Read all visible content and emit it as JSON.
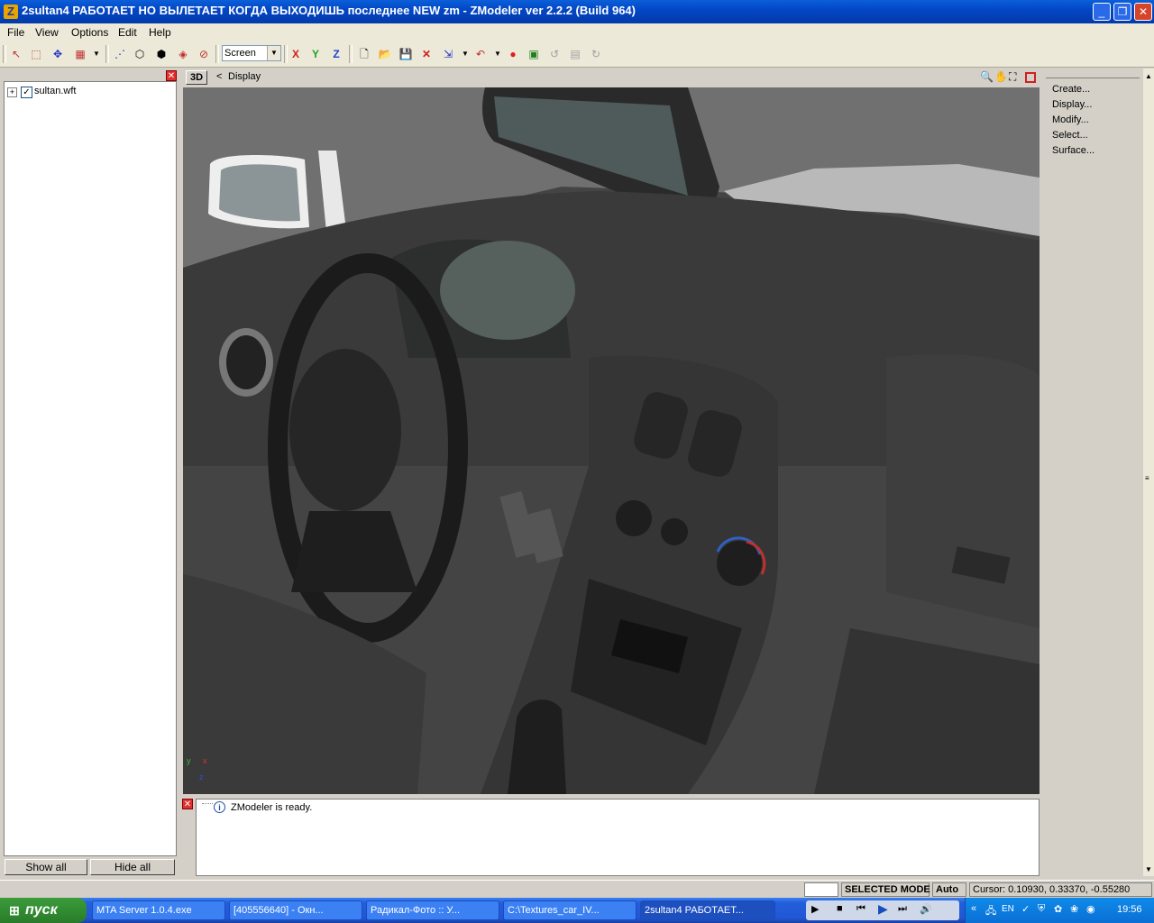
{
  "window": {
    "title": "2sultan4 РАБОТАЕТ НО ВЫЛЕТАЕТ КОГДА ВЫХОДИШЬ последнее NEW zm - ZModeler ver 2.2.2 (Build 964)",
    "app_icon_letter": "Z",
    "minimize_glyph": "_",
    "maximize_glyph": "❐",
    "close_glyph": "✕"
  },
  "menu": {
    "items": [
      {
        "label": "File"
      },
      {
        "label": "View"
      },
      {
        "label": "Options"
      },
      {
        "label": "Edit"
      },
      {
        "label": "Help"
      }
    ]
  },
  "toolbar": {
    "view_select": "Screen",
    "axis_x": "X",
    "axis_y": "Y",
    "axis_z": "Z"
  },
  "tree": {
    "items": [
      {
        "label": "sultan.wft",
        "expander": "+",
        "checked": true
      }
    ]
  },
  "left_buttons": {
    "show_all": "Show all",
    "hide_all": "Hide all"
  },
  "viewport": {
    "mode_label": "3D",
    "nav_arrow": "<",
    "menu_label": "Display",
    "axis_x": "x",
    "axis_y": "y",
    "axis_z": "z"
  },
  "log": {
    "entries": [
      {
        "icon": "info-icon",
        "text": "ZModeler is ready."
      }
    ]
  },
  "commands": {
    "items": [
      {
        "label": "Create..."
      },
      {
        "label": "Display..."
      },
      {
        "label": "Modify..."
      },
      {
        "label": "Select..."
      },
      {
        "label": "Surface..."
      }
    ]
  },
  "status": {
    "mode": "SELECTED MODE",
    "auto": "Auto",
    "cursor": "Cursor: 0.10930, 0.33370, -0.55280"
  },
  "taskbar": {
    "start_label": "пуск",
    "tasks": [
      {
        "label": "MTA Server 1.0.4.exe"
      },
      {
        "label": "[405556640] - Окн..."
      },
      {
        "label": "Радикал-Фото :: У..."
      },
      {
        "label": "C:\\Textures_car_IV..."
      },
      {
        "label": "2sultan4 РАБОТАЕТ..."
      }
    ],
    "lang": "EN",
    "clock": "19:56"
  },
  "colors": {
    "titlebar": "#0347c6",
    "close_red": "#e03030",
    "start_green": "#2f8a2f",
    "taskbar_blue": "#245edb",
    "tray_blue": "#0b6fd4"
  }
}
